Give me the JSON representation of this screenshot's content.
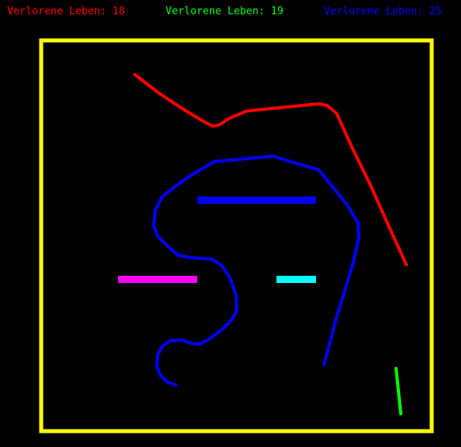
{
  "colors": {
    "background": "#000000",
    "border": "#ffff00",
    "red": "#ff0000",
    "green": "#00ff00",
    "blue": "#0000ff",
    "magenta": "#ff00ff",
    "cyan": "#00ffff"
  },
  "scores": [
    {
      "label": "Verlorene Leben: 18",
      "color": "#ff0000"
    },
    {
      "label": "Verlorene Leben: 19",
      "color": "#00ff00"
    },
    {
      "label": "Verlorene Leben: 25",
      "color": "#0000ff"
    }
  ]
}
